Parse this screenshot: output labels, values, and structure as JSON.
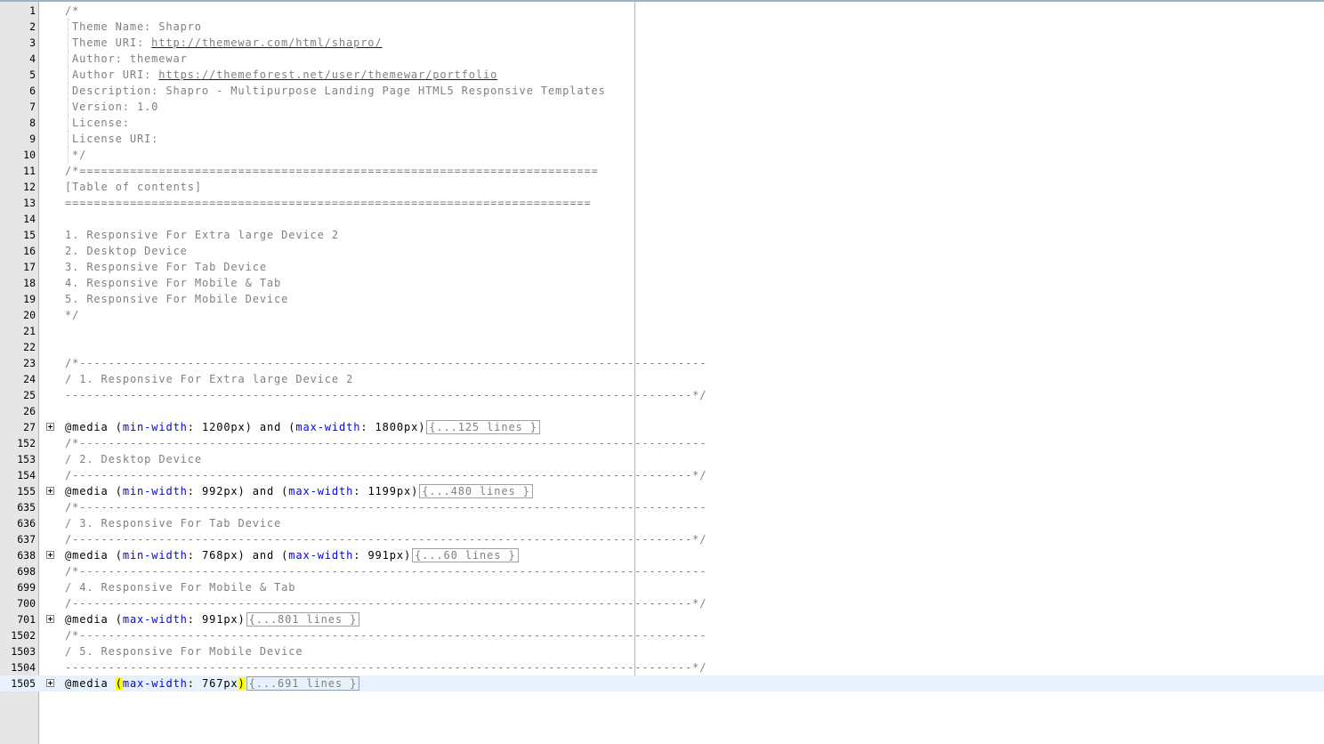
{
  "editor": {
    "comment_header": [
      {
        "ln": "1",
        "text": "/*"
      },
      {
        "ln": "2",
        "text": "Theme Name: Shapro",
        "indent": true
      },
      {
        "ln": "3",
        "text": "Theme URI: ",
        "url": "http://themewar.com/html/shapro/",
        "indent": true
      },
      {
        "ln": "4",
        "text": "Author: themewar",
        "indent": true
      },
      {
        "ln": "5",
        "text": "Author URI: ",
        "url": "https://themeforest.net/user/themewar/portfolio",
        "indent": true
      },
      {
        "ln": "6",
        "text": "Description: Shapro - Multipurpose Landing Page HTML5 Responsive Templates",
        "indent": true
      },
      {
        "ln": "7",
        "text": "Version: 1.0",
        "indent": true
      },
      {
        "ln": "8",
        "text": "License:",
        "indent": true
      },
      {
        "ln": "9",
        "text": "License URI:",
        "indent": true
      },
      {
        "ln": "10",
        "text": "*/",
        "indent": true
      },
      {
        "ln": "11",
        "text": "/*========================================================================"
      },
      {
        "ln": "12",
        "text": "[Table of contents]"
      },
      {
        "ln": "13",
        "text": "========================================================================="
      },
      {
        "ln": "14",
        "text": ""
      },
      {
        "ln": "15",
        "text": "1. Responsive For Extra large Device 2"
      },
      {
        "ln": "16",
        "text": "2. Desktop Device"
      },
      {
        "ln": "17",
        "text": "3. Responsive For Tab Device"
      },
      {
        "ln": "18",
        "text": "4. Responsive For Mobile & Tab"
      },
      {
        "ln": "19",
        "text": "5. Responsive For Mobile Device"
      },
      {
        "ln": "20",
        "text": "*/"
      },
      {
        "ln": "21",
        "text": ""
      },
      {
        "ln": "22",
        "text": ""
      }
    ],
    "sections": [
      {
        "open": {
          "ln": "23",
          "text": "/*---------------------------------------------------------------------------------------"
        },
        "title": {
          "ln": "24",
          "text": "/ 1. Responsive For Extra large Device 2"
        },
        "close": {
          "ln": "25",
          "text": "---------------------------------------------------------------------------------------*/"
        },
        "blank": {
          "ln": "26",
          "text": ""
        },
        "media": {
          "ln": "27",
          "prefix": "@media ",
          "parts": [
            {
              "t": "(",
              "c": "kw"
            },
            {
              "t": "min-width",
              "c": "prop"
            },
            {
              "t": ": 1200px",
              "c": "val"
            },
            {
              "t": ")",
              "c": "kw"
            },
            {
              "t": " and ",
              "c": "kw"
            },
            {
              "t": "(",
              "c": "kw"
            },
            {
              "t": "max-width",
              "c": "prop"
            },
            {
              "t": ": 1800px",
              "c": "val"
            },
            {
              "t": ")",
              "c": "kw"
            }
          ],
          "folded": "{...125 lines }"
        }
      },
      {
        "open": {
          "ln": "152",
          "text": "/*---------------------------------------------------------------------------------------"
        },
        "title": {
          "ln": "153",
          "text": "/ 2. Desktop Device"
        },
        "close": {
          "ln": "154",
          "text": "/--------------------------------------------------------------------------------------*/"
        },
        "media": {
          "ln": "155",
          "prefix": "@media ",
          "parts": [
            {
              "t": "(",
              "c": "kw"
            },
            {
              "t": "min-width",
              "c": "prop"
            },
            {
              "t": ": 992px",
              "c": "val"
            },
            {
              "t": ")",
              "c": "kw"
            },
            {
              "t": " and ",
              "c": "kw"
            },
            {
              "t": "(",
              "c": "kw"
            },
            {
              "t": "max-width",
              "c": "prop"
            },
            {
              "t": ": 1199px",
              "c": "val"
            },
            {
              "t": ")",
              "c": "kw"
            }
          ],
          "folded": "{...480 lines }"
        }
      },
      {
        "open": {
          "ln": "635",
          "text": "/*---------------------------------------------------------------------------------------"
        },
        "title": {
          "ln": "636",
          "text": "/ 3. Responsive For Tab Device"
        },
        "close": {
          "ln": "637",
          "text": "/--------------------------------------------------------------------------------------*/"
        },
        "media": {
          "ln": "638",
          "prefix": "@media ",
          "parts": [
            {
              "t": "(",
              "c": "kw"
            },
            {
              "t": "min-width",
              "c": "prop"
            },
            {
              "t": ": 768px",
              "c": "val"
            },
            {
              "t": ")",
              "c": "kw"
            },
            {
              "t": " and ",
              "c": "kw"
            },
            {
              "t": "(",
              "c": "kw"
            },
            {
              "t": "max-width",
              "c": "prop"
            },
            {
              "t": ": 991px",
              "c": "val"
            },
            {
              "t": ")",
              "c": "kw"
            }
          ],
          "folded": "{...60 lines }"
        }
      },
      {
        "open": {
          "ln": "698",
          "text": "/*---------------------------------------------------------------------------------------"
        },
        "title": {
          "ln": "699",
          "text": "/ 4. Responsive For Mobile & Tab"
        },
        "close": {
          "ln": "700",
          "text": "/--------------------------------------------------------------------------------------*/"
        },
        "media": {
          "ln": "701",
          "prefix": "@media ",
          "parts": [
            {
              "t": "(",
              "c": "kw"
            },
            {
              "t": "max-width",
              "c": "prop"
            },
            {
              "t": ": 991px",
              "c": "val"
            },
            {
              "t": ")",
              "c": "kw"
            }
          ],
          "folded": "{...801 lines }"
        }
      },
      {
        "open": {
          "ln": "1502",
          "text": "/*---------------------------------------------------------------------------------------"
        },
        "title": {
          "ln": "1503",
          "text": "/ 5. Responsive For Mobile Device"
        },
        "close": {
          "ln": "1504",
          "text": "---------------------------------------------------------------------------------------*/"
        },
        "media": {
          "ln": "1505",
          "prefix": "@media ",
          "current": true,
          "parts": [
            {
              "t": "(",
              "c": "bracket hl"
            },
            {
              "t": "max-width",
              "c": "prop"
            },
            {
              "t": ": 767px",
              "c": "val"
            },
            {
              "t": ")",
              "c": "bracket hl"
            }
          ],
          "folded": "{...691 lines }"
        }
      }
    ]
  },
  "colors": {
    "gutter": "#e6e6e6",
    "comment": "#808080",
    "property": "#0000ff",
    "brace_highlight": "#ffff00",
    "url_underline": "#0000ff",
    "edge_line": "#d7a9a9"
  }
}
